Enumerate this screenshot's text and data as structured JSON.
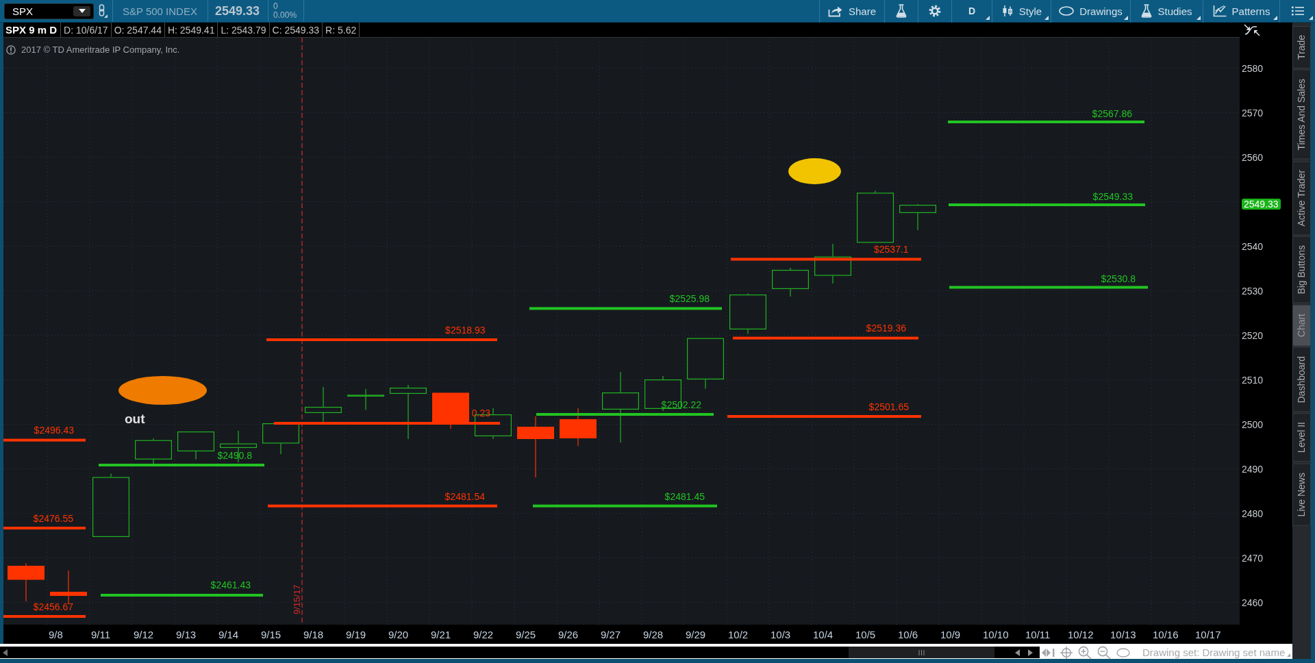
{
  "toolbar": {
    "symbol": "SPX",
    "description": "S&P 500 INDEX",
    "last_price": "2549.33",
    "net_change": "0",
    "percent_change": "0.00%",
    "buttons": [
      {
        "kind": "share",
        "label": "Share",
        "dropdown": false
      },
      {
        "kind": "flask",
        "dropdown": false
      },
      {
        "kind": "gear",
        "dropdown": false
      },
      {
        "kind": "aggregation",
        "label": "D",
        "dropdown": true
      },
      {
        "kind": "style",
        "label": "Style",
        "dropdown": true
      },
      {
        "kind": "drawings",
        "label": "Drawings",
        "dropdown": true
      },
      {
        "kind": "studies",
        "label": "Studies",
        "dropdown": true
      },
      {
        "kind": "patterns",
        "label": "Patterns",
        "dropdown": true
      },
      {
        "kind": "menu",
        "dropdown": true
      }
    ]
  },
  "info_bar": {
    "title": "SPX 9 m D",
    "fields": [
      "D: 10/6/17",
      "O: 2547.44",
      "H: 2549.41",
      "L: 2543.79",
      "C: 2549.33",
      "R: 5.62"
    ]
  },
  "chart": {
    "copyright": "2017 © TD Ameritrade IP Company, Inc.",
    "annotations": [
      {
        "kind": "ellipse",
        "color": "#ef7b00"
      },
      {
        "kind": "text",
        "text": "out"
      },
      {
        "kind": "ellipse",
        "color": "#f2c400"
      }
    ],
    "price_levels": [
      {
        "label": "$2496.43",
        "color": "#ff3300"
      },
      {
        "label": "$2476.55",
        "color": "#ff3300"
      },
      {
        "label": "$2456.67",
        "color": "#ff3300"
      },
      {
        "label": "$2490.8",
        "color": "#22c322"
      },
      {
        "label": "$2461.43",
        "color": "#22c322"
      },
      {
        "label": "$2518.93",
        "color": "#ff3300"
      },
      {
        "label": "0.23",
        "color": "#ff3300"
      },
      {
        "label": "$2481.54",
        "color": "#ff3300"
      },
      {
        "label": "$2525.98",
        "color": "#22c322"
      },
      {
        "label": "$2502.22",
        "color": "#22c322"
      },
      {
        "label": "$2481.45",
        "color": "#22c322"
      },
      {
        "label": "$2537.1",
        "color": "#ff3300"
      },
      {
        "label": "$2519.36",
        "color": "#ff3300"
      },
      {
        "label": "$2501.65",
        "color": "#ff3300"
      },
      {
        "label": "$2567.86",
        "color": "#22c322"
      },
      {
        "label": "$2549.33",
        "color": "#22c322"
      },
      {
        "label": "$2530.8",
        "color": "#22c322"
      }
    ],
    "date_marker": "9/15/17",
    "price_axis": [
      {
        "kind": "tick",
        "label": "2580"
      },
      {
        "kind": "tick",
        "label": "2570"
      },
      {
        "kind": "tick",
        "label": "2560"
      },
      {
        "kind": "current",
        "label": "2549.33"
      },
      {
        "kind": "tick",
        "label": "2540"
      },
      {
        "kind": "tick",
        "label": "2530"
      },
      {
        "kind": "tick",
        "label": "2520"
      },
      {
        "kind": "tick",
        "label": "2510"
      },
      {
        "kind": "tick",
        "label": "2500"
      },
      {
        "kind": "tick",
        "label": "2490"
      },
      {
        "kind": "tick",
        "label": "2480"
      },
      {
        "kind": "tick",
        "label": "2470"
      },
      {
        "kind": "tick",
        "label": "2460"
      }
    ],
    "date_axis": [
      "9/8",
      "9/11",
      "9/12",
      "9/13",
      "9/14",
      "9/15",
      "9/18",
      "9/19",
      "9/20",
      "9/21",
      "9/22",
      "9/25",
      "9/26",
      "9/27",
      "9/28",
      "9/29",
      "10/2",
      "10/3",
      "10/4",
      "10/5",
      "10/6",
      "10/9",
      "10/10",
      "10/11",
      "10/12",
      "10/13",
      "10/16",
      "10/17"
    ]
  },
  "side_tabs": [
    {
      "label": "Trade",
      "selected": false
    },
    {
      "label": "Times And Sales",
      "selected": false
    },
    {
      "label": "Active Trader",
      "selected": false
    },
    {
      "label": "Big Buttons",
      "selected": false
    },
    {
      "label": "Chart",
      "selected": true
    },
    {
      "label": "Dashboard",
      "selected": false
    },
    {
      "label": "Level II",
      "selected": false
    },
    {
      "label": "Live News",
      "selected": false
    }
  ],
  "status_bar": {
    "drawing_set_label": "Drawing set:",
    "drawing_set_name": "Drawing set name"
  }
}
